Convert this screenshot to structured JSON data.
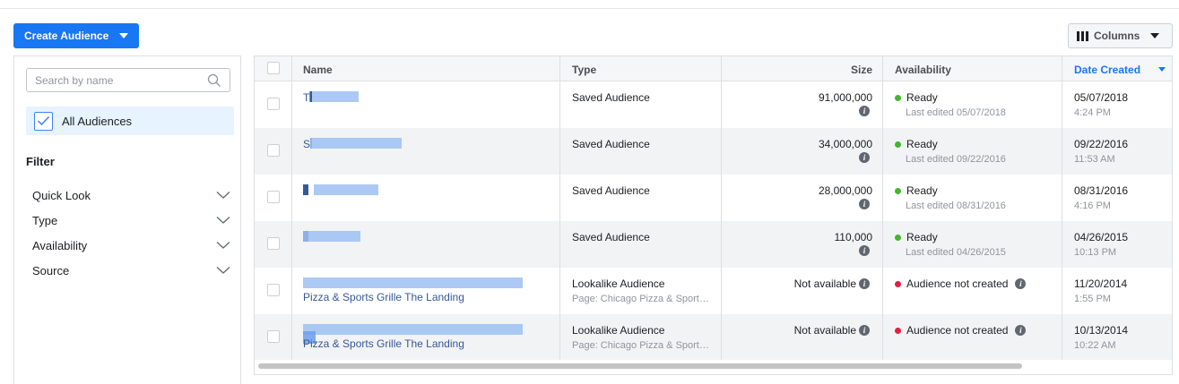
{
  "toolbar": {
    "create_label": "Create Audience",
    "columns_label": "Columns"
  },
  "sidebar": {
    "search_placeholder": "Search by name",
    "all_audiences_label": "All Audiences",
    "filter_title": "Filter",
    "filters": [
      "Quick Look",
      "Type",
      "Availability",
      "Source"
    ]
  },
  "table": {
    "headers": {
      "name": "Name",
      "type": "Type",
      "size": "Size",
      "availability": "Availability",
      "date_created": "Date Created"
    },
    "sorted_column": "Date Created",
    "rows": [
      {
        "name": "T█ ██",
        "type": "Saved Audience",
        "type_sub": "",
        "size": "91,000,000",
        "status": "Ready",
        "status_color": "#42b72a",
        "status_sub": "Last edited 05/07/2018",
        "date": "05/07/2018",
        "time": "4:24 PM"
      },
      {
        "name": "S█ C█ ██",
        "type": "Saved Audience",
        "type_sub": "",
        "size": "34,000,000",
        "status": "Ready",
        "status_color": "#42b72a",
        "status_sub": "Last edited 09/22/2016",
        "date": "09/22/2016",
        "time": "11:53 AM"
      },
      {
        "name": "█",
        "type": "Saved Audience",
        "type_sub": "",
        "size": "28,000,000",
        "status": "Ready",
        "status_color": "#42b72a",
        "status_sub": "Last edited 08/31/2016",
        "date": "08/31/2016",
        "time": "4:16 PM"
      },
      {
        "name": "█",
        "type": "Saved Audience",
        "type_sub": "",
        "size": "110,000",
        "status": "Ready",
        "status_color": "#42b72a",
        "status_sub": "Last edited 04/26/2015",
        "date": "04/26/2015",
        "time": "10:13 PM"
      },
      {
        "name": "Pizza & Sports Grille The Landing",
        "type": "Lookalike Audience",
        "type_sub": "Page: Chicago Pizza & Sport…",
        "size": "Not available",
        "status": "Audience not created",
        "status_color": "#e41e3f",
        "status_sub": "",
        "date": "11/20/2014",
        "time": "1:55 PM"
      },
      {
        "name": "Pizza & Sports Grille The Landing",
        "type": "Lookalike Audience",
        "type_sub": "Page: Chicago Pizza & Sport…",
        "size": "Not available",
        "status": "Audience not created",
        "status_color": "#e41e3f",
        "status_sub": "",
        "date": "10/13/2014",
        "time": "10:22 AM"
      }
    ]
  },
  "icons": {
    "search": "search-icon",
    "check": "check-icon",
    "chevron": "chevron-down-icon",
    "info": "info-icon",
    "columns": "columns-icon"
  },
  "colors": {
    "accent": "#1877f2",
    "link": "#365899",
    "ready": "#42b72a",
    "not_created": "#e41e3f"
  }
}
